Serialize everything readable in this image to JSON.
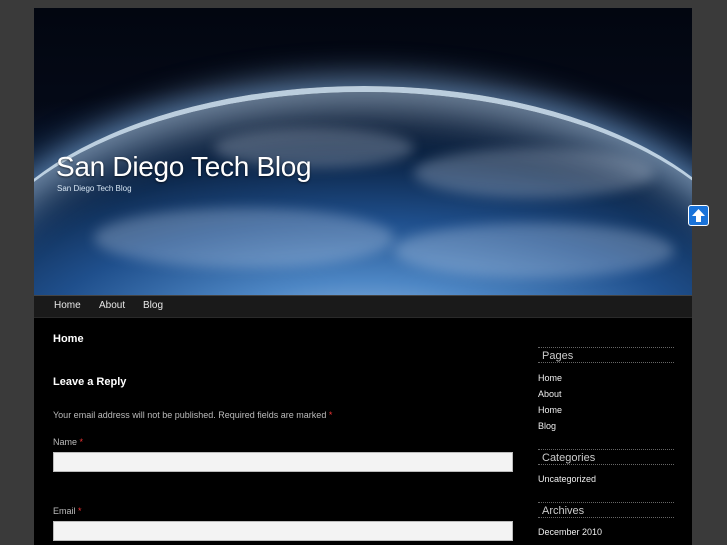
{
  "site": {
    "title": "San Diego Tech Blog",
    "tagline": "San Diego Tech Blog"
  },
  "nav": {
    "items": [
      {
        "label": "Home"
      },
      {
        "label": "About"
      },
      {
        "label": "Blog"
      }
    ]
  },
  "main": {
    "page_heading": "Home",
    "reply_heading": "Leave a Reply",
    "notes_text": "Your email address will not be published. Required fields are marked",
    "required_marker": "*",
    "name_label": "Name",
    "email_label": "Email",
    "name_value": "",
    "email_value": ""
  },
  "sidebar": {
    "pages": {
      "title": "Pages",
      "items": [
        {
          "label": "Home"
        },
        {
          "label": "About"
        },
        {
          "label": "Home"
        },
        {
          "label": "Blog"
        }
      ]
    },
    "categories": {
      "title": "Categories",
      "items": [
        {
          "label": "Uncategorized"
        }
      ]
    },
    "archives": {
      "title": "Archives",
      "items": [
        {
          "label": "December 2010"
        }
      ]
    }
  },
  "icons": {
    "scroll_top": "arrow-up-icon"
  },
  "colors": {
    "accent": "#1a73d9",
    "required": "#ee3333",
    "background": "#3a3a3a",
    "content_bg": "#000000"
  }
}
